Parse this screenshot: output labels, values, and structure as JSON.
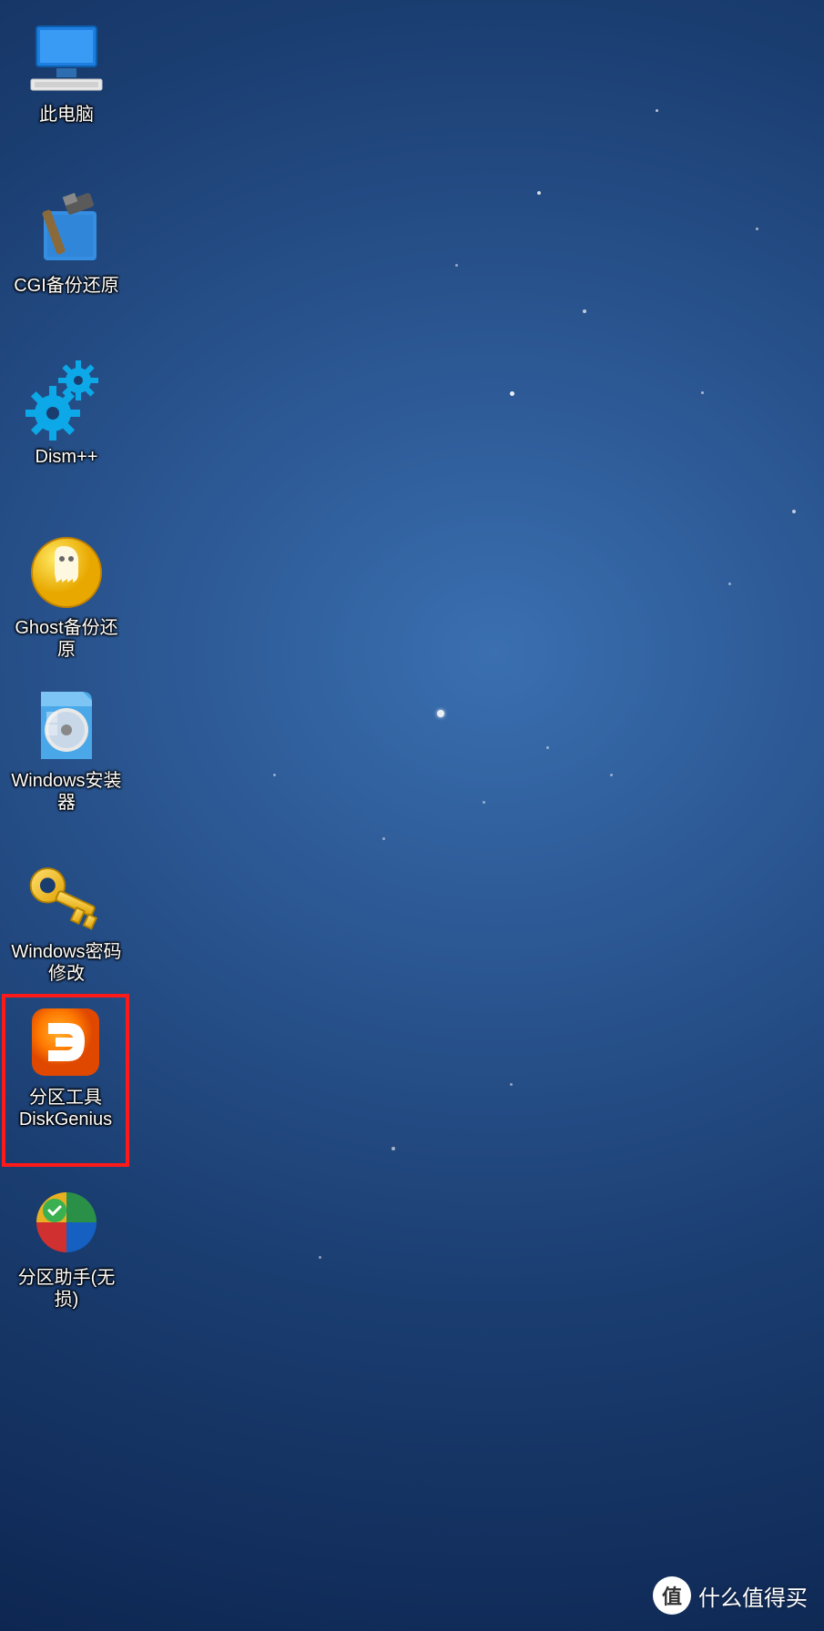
{
  "icons": [
    {
      "id": "this-pc",
      "label": "此电脑",
      "glyph": "computer-icon"
    },
    {
      "id": "cgi-backup",
      "label": "CGI备份还原",
      "glyph": "hammer-icon"
    },
    {
      "id": "dism",
      "label": "Dism++",
      "glyph": "gears-icon"
    },
    {
      "id": "ghost-backup",
      "label": "Ghost备份还原",
      "glyph": "ghost-icon"
    },
    {
      "id": "windows-installer",
      "label": "Windows安装器",
      "glyph": "disc-icon"
    },
    {
      "id": "windows-password",
      "label": "Windows密码修改",
      "glyph": "key-icon"
    },
    {
      "id": "diskgenius",
      "label": "分区工具DiskGenius",
      "glyph": "diskgenius-icon",
      "highlighted": true
    },
    {
      "id": "partition-assistant",
      "label": "分区助手(无损)",
      "glyph": "partition-icon"
    }
  ],
  "watermark": {
    "badge": "值",
    "text": "什么值得买"
  }
}
